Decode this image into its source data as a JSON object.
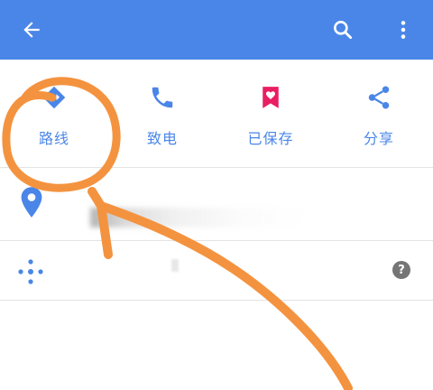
{
  "colors": {
    "appbar": "#4a86e8",
    "accent": "#4a86e8",
    "saved": "#e91e63",
    "annotation": "#f4933f"
  },
  "appbar": {
    "back_icon": "arrow-left-icon",
    "search_icon": "search-icon",
    "more_icon": "more-vert-icon"
  },
  "actions": [
    {
      "label": "路线",
      "icon": "directions-icon"
    },
    {
      "label": "致电",
      "icon": "phone-icon"
    },
    {
      "label": "已保存",
      "icon": "bookmark-heart-icon"
    },
    {
      "label": "分享",
      "icon": "share-icon"
    }
  ],
  "rows": {
    "address_icon": "place-pin-icon",
    "plus_code_icon": "plus-code-icon",
    "help_icon": "help-icon",
    "help_glyph": "?"
  }
}
